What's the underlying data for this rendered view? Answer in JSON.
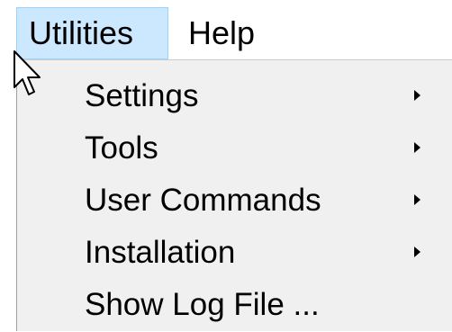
{
  "menubar": {
    "items": [
      {
        "label": "Utilities"
      },
      {
        "label": "Help"
      }
    ]
  },
  "dropdown": {
    "items": [
      {
        "label": "Settings",
        "icon": "chevron-right-icon"
      },
      {
        "label": "Tools",
        "icon": "chevron-right-icon"
      },
      {
        "label": "User Commands",
        "icon": "chevron-right-icon"
      },
      {
        "label": "Installation",
        "icon": "chevron-right-icon"
      },
      {
        "label": "Show Log File ..."
      }
    ]
  },
  "colors": {
    "menubar_active_bg": "#cce8ff",
    "menubar_active_border": "#99d1ff",
    "dropdown_bg": "#f0f0f0",
    "text": "#000000"
  }
}
